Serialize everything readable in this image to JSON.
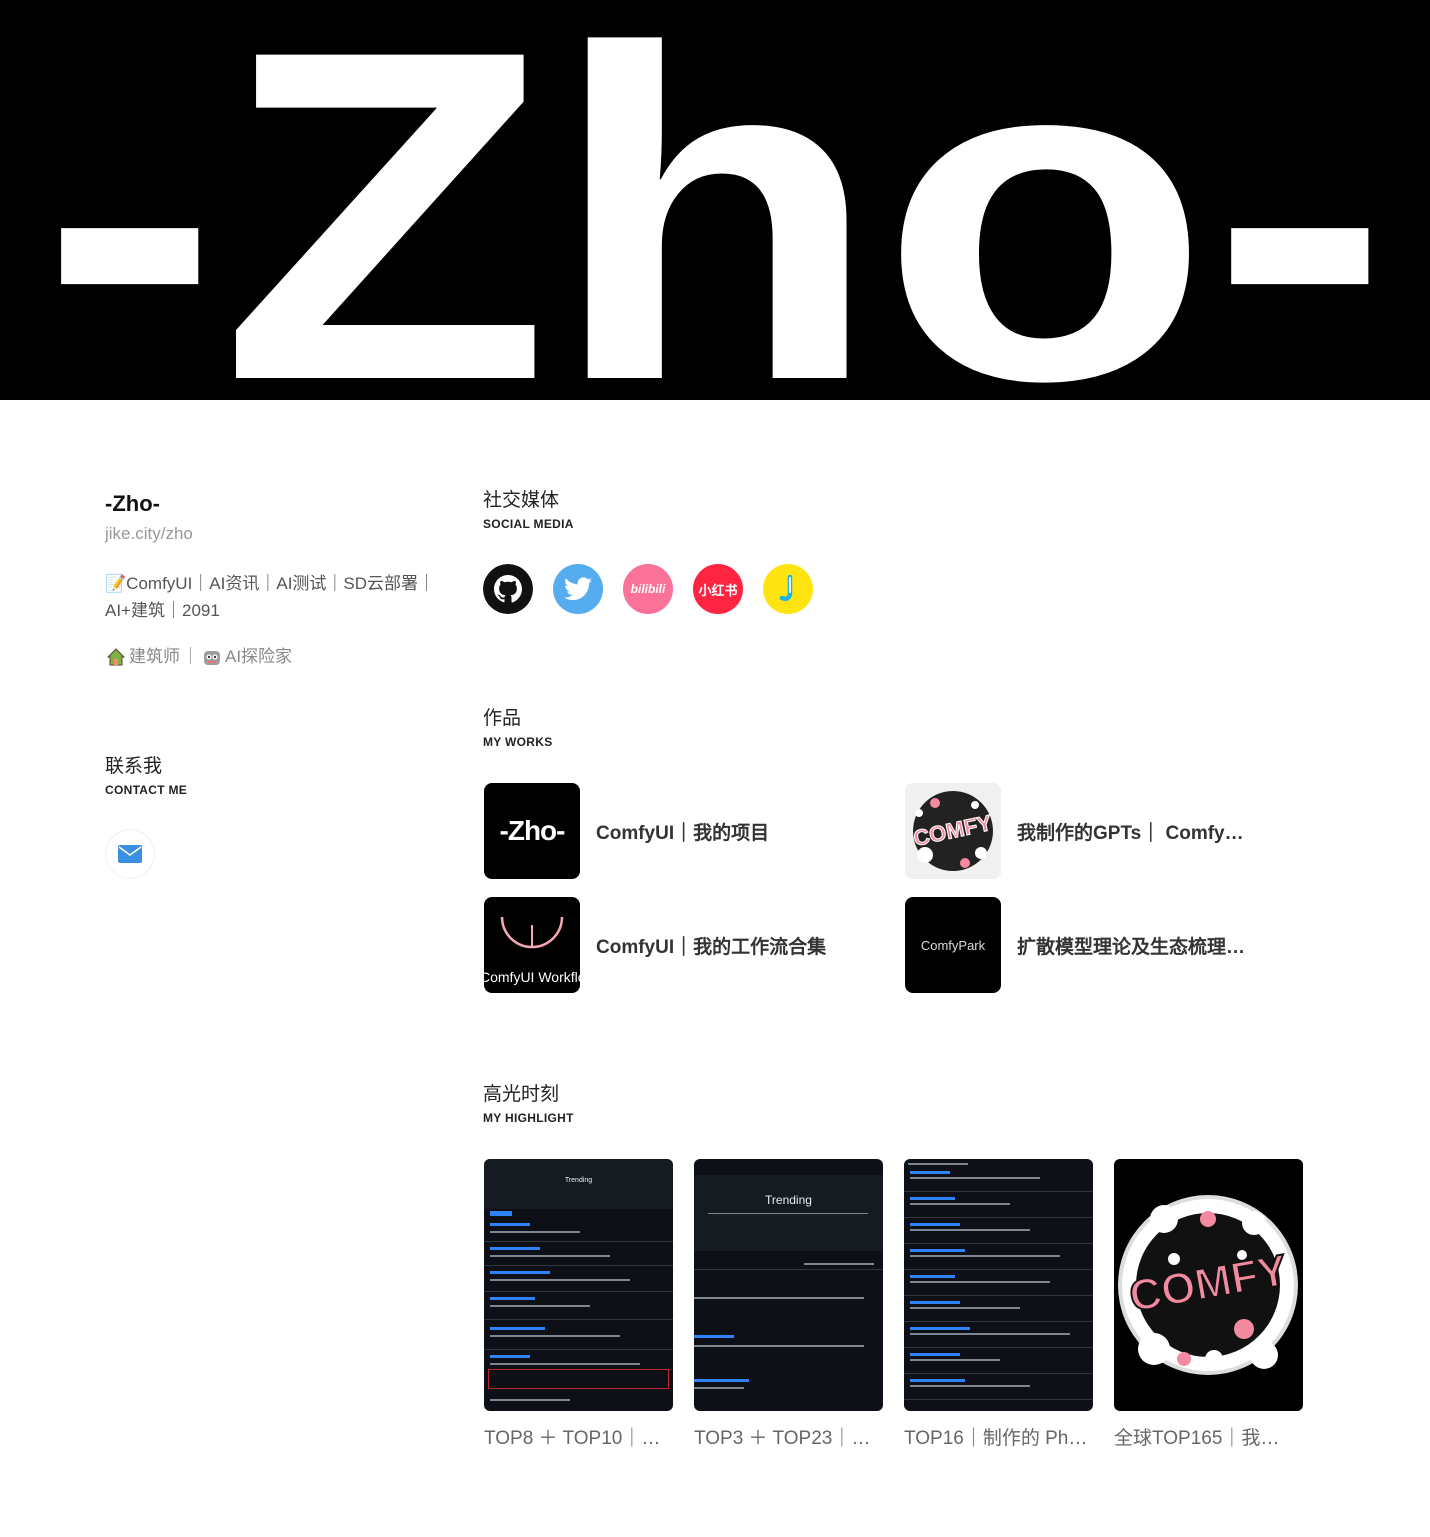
{
  "banner": {
    "logo_text": "-Zho-"
  },
  "profile": {
    "name": "-Zho-",
    "url": "jike.city/zho",
    "bio_emoji": "📝",
    "bio": "ComfyUI｜AI资讯｜AI测试｜SD云部署｜AI+建筑｜2091",
    "tag1": "建筑师",
    "separator": "｜",
    "tag2": "AI探险家"
  },
  "contact": {
    "title": "联系我",
    "subtitle": "CONTACT ME"
  },
  "social": {
    "title": "社交媒体",
    "subtitle": "SOCIAL MEDIA",
    "icons": [
      {
        "name": "github-icon",
        "color": "#000000"
      },
      {
        "name": "twitter-icon",
        "color": "#55acee"
      },
      {
        "name": "bilibili-icon",
        "color": "#fb7299",
        "label": "bilibili"
      },
      {
        "name": "xiaohongshu-icon",
        "color": "#ff2442",
        "label": "小红书"
      },
      {
        "name": "jike-icon",
        "color": "#ffe411"
      }
    ]
  },
  "works": {
    "title": "作品",
    "subtitle": "MY WORKS",
    "items": [
      {
        "title": "ComfyUI｜我的项目",
        "thumb_text": "-Zho-"
      },
      {
        "title": "我制作的GPTs｜ Comfy…",
        "thumb_text": "COMFY"
      },
      {
        "title": "ComfyUI｜我的工作流合集",
        "thumb_text": "ComfyUI Workflow"
      },
      {
        "title": "扩散模型理论及生态梳理…",
        "thumb_text": "ComfyPark"
      }
    ]
  },
  "highlight": {
    "title": "高光时刻",
    "subtitle": "MY HIGHLIGHT",
    "items": [
      {
        "caption": "TOP8 ＋ TOP10｜…",
        "screen_title": "Trending"
      },
      {
        "caption": "TOP3 ＋ TOP23｜…",
        "screen_title": "Trending"
      },
      {
        "caption": "TOP16｜制作的 Ph…"
      },
      {
        "caption": "全球TOP165｜我…",
        "thumb_text": "COMFY"
      }
    ]
  },
  "colors": {
    "accent_pink": "#f48aa0",
    "mail_blue": "#3b8fe0"
  }
}
